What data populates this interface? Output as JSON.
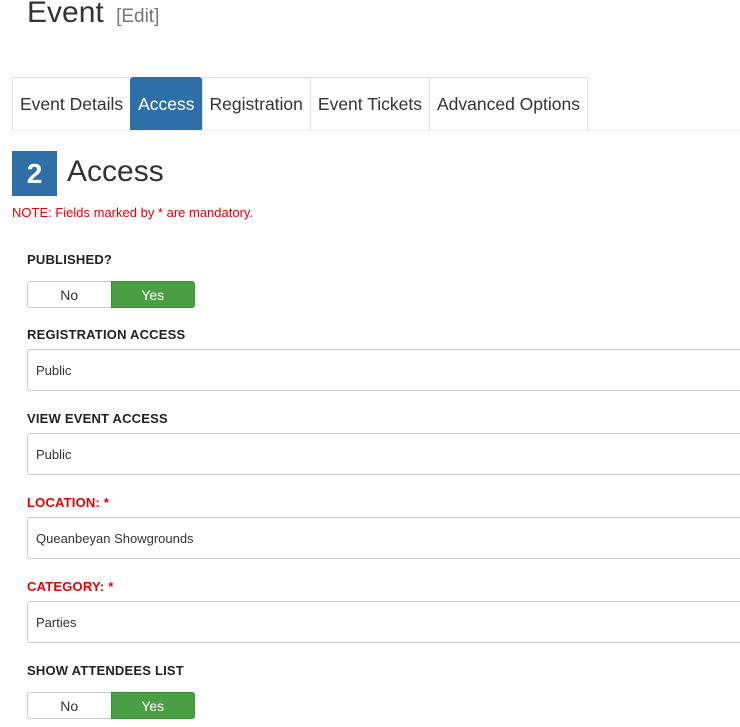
{
  "header": {
    "title": "Event",
    "edit_label": "[Edit]"
  },
  "tabs": [
    {
      "label": "Event Details",
      "active": false
    },
    {
      "label": "Access",
      "active": true
    },
    {
      "label": "Registration",
      "active": false
    },
    {
      "label": "Event Tickets",
      "active": false
    },
    {
      "label": "Advanced Options",
      "active": false
    }
  ],
  "section": {
    "step_number": "2",
    "title": "Access",
    "note": "NOTE: Fields marked by * are mandatory."
  },
  "fields": {
    "published": {
      "label": "PUBLISHED?",
      "no_label": "No",
      "yes_label": "Yes",
      "value": "Yes"
    },
    "registration_access": {
      "label": "REGISTRATION ACCESS",
      "value": "Public"
    },
    "view_event_access": {
      "label": "VIEW EVENT ACCESS",
      "value": "Public"
    },
    "location": {
      "label": "LOCATION: *",
      "value": "Queanbeyan Showgrounds",
      "required": true
    },
    "category": {
      "label": "CATEGORY: *",
      "value": "Parties",
      "required": true
    },
    "show_attendees_list": {
      "label": "SHOW ATTENDEES LIST",
      "no_label": "No",
      "yes_label": "Yes",
      "value": "Yes"
    }
  },
  "colors": {
    "accent": "#2f6fa8",
    "yes_green": "#4a9e44",
    "required_red": "#e60000"
  }
}
